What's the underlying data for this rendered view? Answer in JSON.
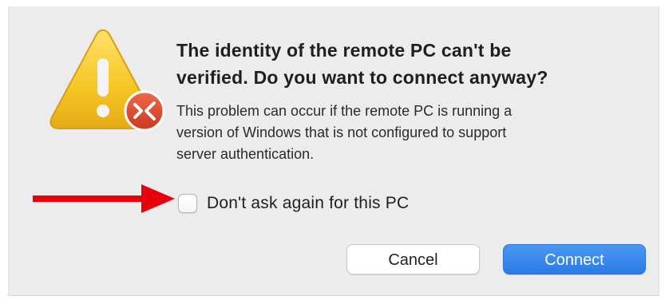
{
  "dialog": {
    "title_lines": [
      "The identity of the remote PC can't be",
      "verified. Do you want to connect anyway?"
    ],
    "message_lines": [
      "This problem can occur if the remote PC is running a",
      "version of Windows that is not configured to support",
      "server authentication."
    ],
    "checkbox": {
      "label": "Don't ask again for this PC",
      "checked": false
    },
    "buttons": {
      "cancel": "Cancel",
      "connect": "Connect"
    },
    "icons": {
      "main": "warning-triangle-icon",
      "badge": "remote-desktop-icon"
    }
  },
  "annotation": {
    "arrow_icon": "red-arrow-icon",
    "arrow_color": "#e8000b"
  },
  "colors": {
    "dialog_background": "#ececec",
    "connect_button": "#2a7be6",
    "warning_yellow": "#f4c21e",
    "badge_red": "#d9472b"
  }
}
